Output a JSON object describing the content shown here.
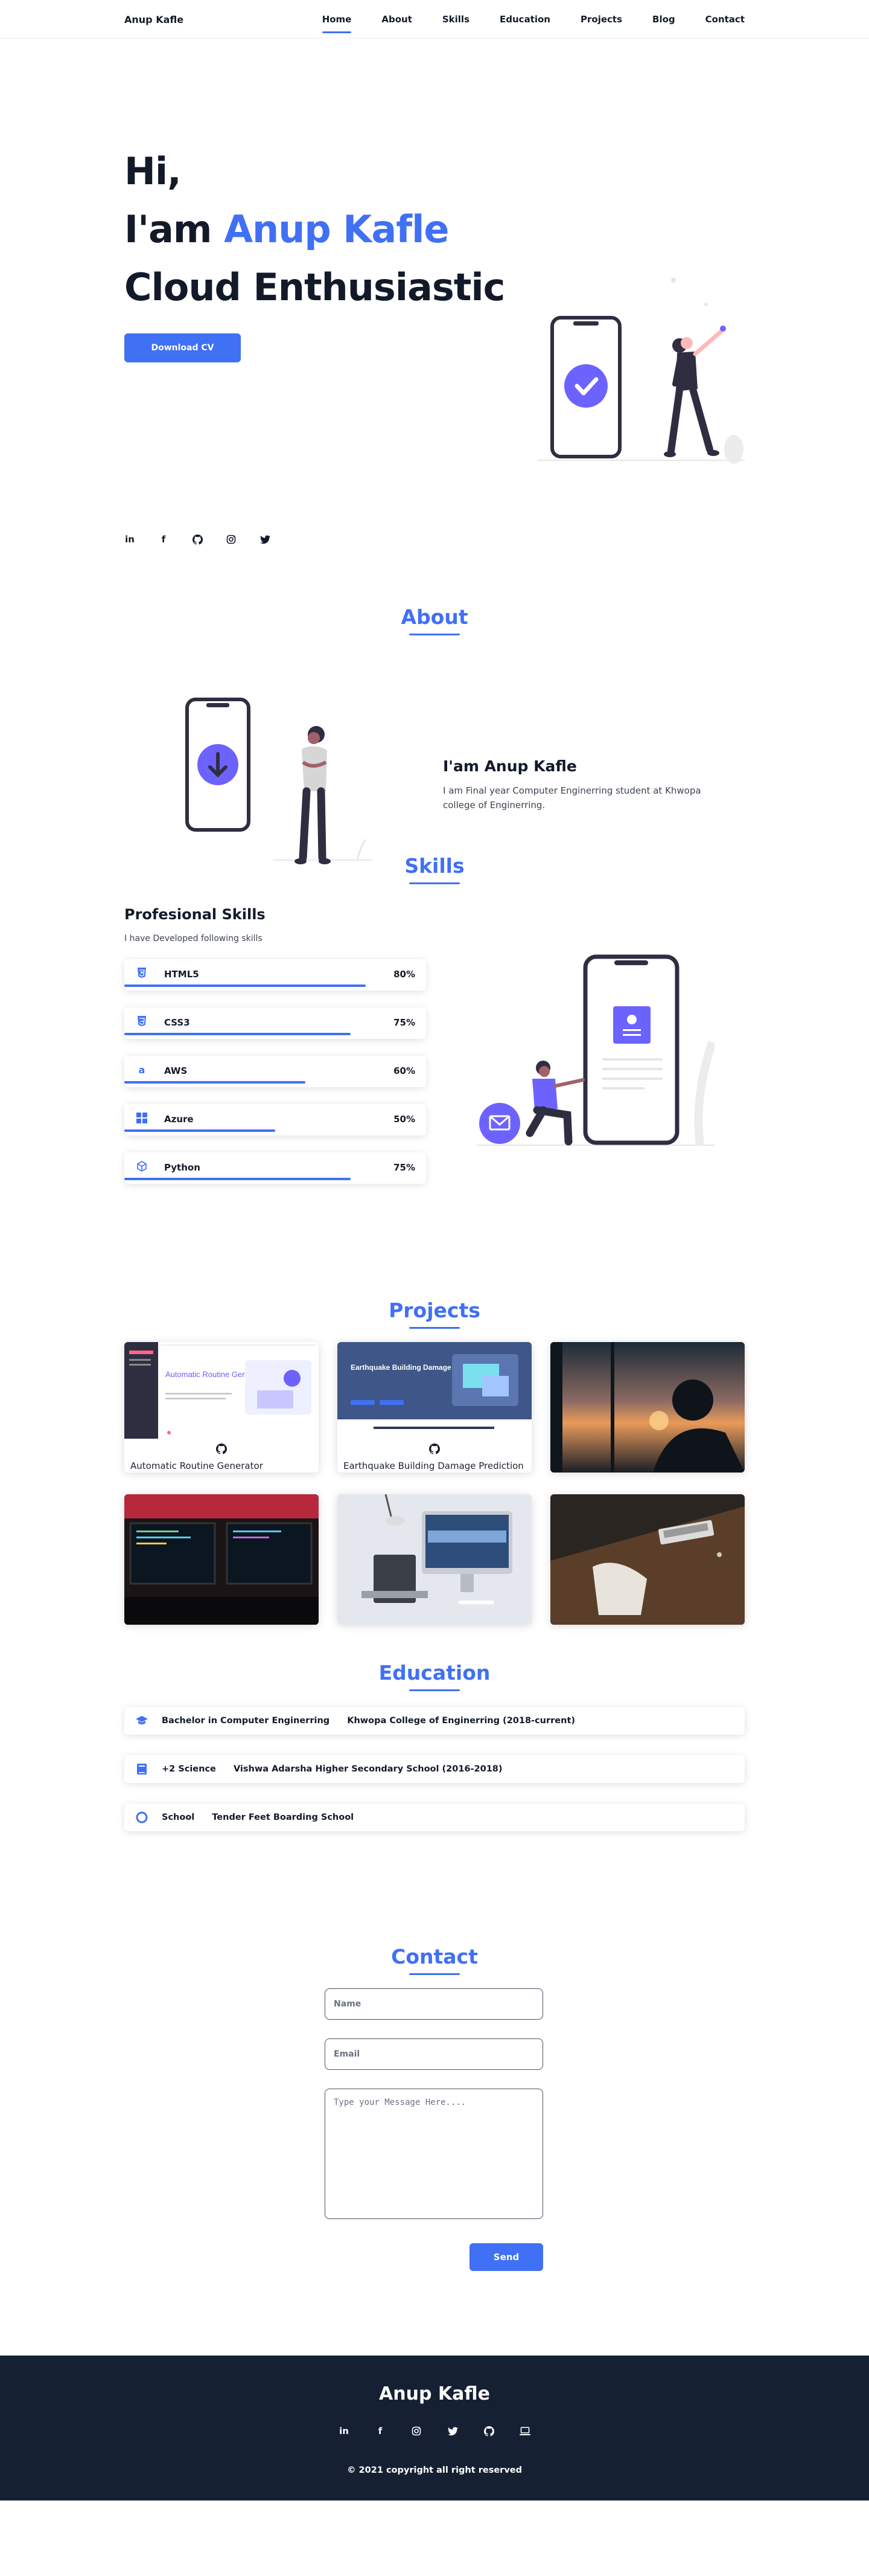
{
  "header": {
    "logo": "Anup Kafle",
    "nav": [
      "Home",
      "About",
      "Skills",
      "Education",
      "Projects",
      "Blog",
      "Contact"
    ],
    "active": "Home"
  },
  "hero": {
    "line1": "Hi,",
    "line2_prefix": "I'am ",
    "line2_name": "Anup Kafle",
    "line3": "Cloud Enthusiastic",
    "cta": "Download CV"
  },
  "socials": [
    "linkedin-icon",
    "facebook-icon",
    "github-icon",
    "instagram-icon",
    "twitter-icon"
  ],
  "about": {
    "title": "About",
    "heading": "I'am Anup Kafle",
    "body": "I am Final year Computer Enginerring student at Khwopa college of Enginerring."
  },
  "skills": {
    "title": "Skills",
    "heading": "Profesional Skills",
    "sub": "I have Developed following skills",
    "items": [
      {
        "name": "HTML5",
        "percent": "80%",
        "fill": 0.8,
        "icon": "html5-icon"
      },
      {
        "name": "CSS3",
        "percent": "75%",
        "fill": 0.75,
        "icon": "css3-icon"
      },
      {
        "name": "AWS",
        "percent": "60%",
        "fill": 0.6,
        "icon": "aws-icon"
      },
      {
        "name": "Azure",
        "percent": "50%",
        "fill": 0.5,
        "icon": "azure-icon"
      },
      {
        "name": "Python",
        "percent": "75%",
        "fill": 0.75,
        "icon": "python-icon"
      }
    ]
  },
  "projects": {
    "title": "Projects",
    "cards": [
      {
        "caption": "Automatic Routine Generator",
        "preview_heading": "Automatic Routine Generator"
      },
      {
        "caption": "Earthquake Building Damage Prediction",
        "preview_heading": "Earthquake Building Damage Prediction"
      },
      {
        "caption": ""
      },
      {
        "caption": ""
      },
      {
        "caption": ""
      },
      {
        "caption": ""
      }
    ]
  },
  "education": {
    "title": "Education",
    "items": [
      {
        "degree": "Bachelor in Computer Enginerring",
        "school": "Khwopa College of Enginerring (2018-current)",
        "icon": "graduation-cap-icon"
      },
      {
        "degree": "+2 Science",
        "school": "Vishwa Adarsha Higher Secondary School (2016-2018)",
        "icon": "book-icon"
      },
      {
        "degree": "School",
        "school": "Tender Feet Boarding School",
        "icon": "circle-icon"
      }
    ]
  },
  "contact": {
    "title": "Contact",
    "name_placeholder": "Name",
    "email_placeholder": "Email",
    "message_placeholder": "Type your Message Here....",
    "send": "Send"
  },
  "footer": {
    "name": "Anup Kafle",
    "socials": [
      "linkedin-icon",
      "facebook-icon",
      "instagram-icon",
      "twitter-icon",
      "github-icon",
      "laptop-icon"
    ],
    "copyright": "© 2021 copyright all right reserved"
  },
  "colors": {
    "accent": "#4070f4",
    "illustration": "#6c63ff",
    "dark": "#162033"
  }
}
